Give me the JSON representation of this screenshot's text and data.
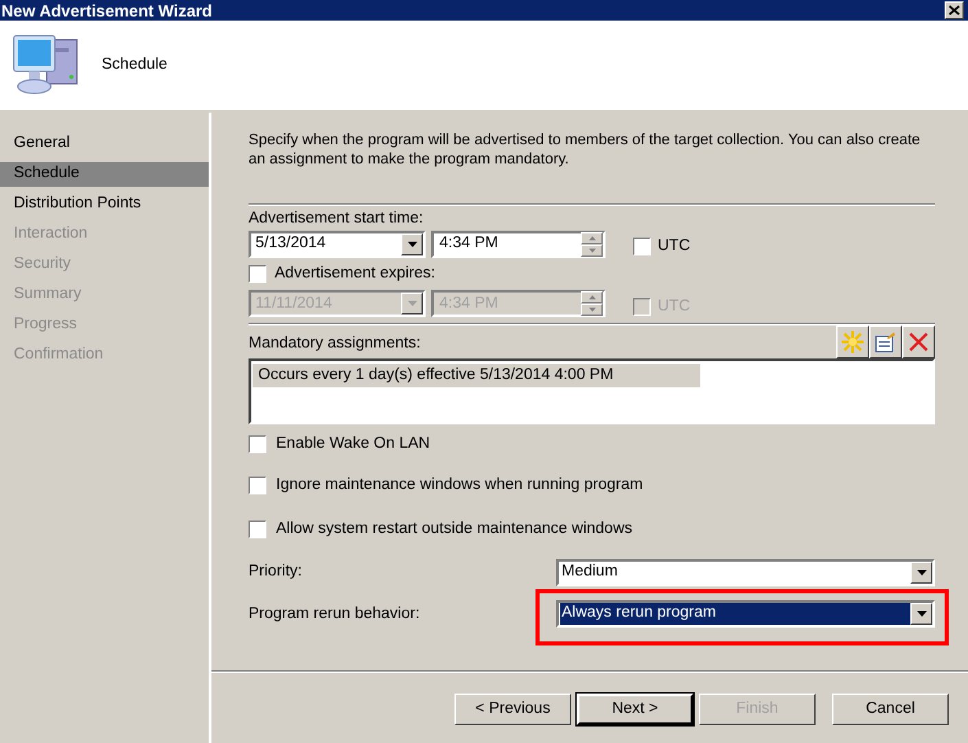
{
  "window": {
    "title": "New Advertisement Wizard"
  },
  "header": {
    "title": "Schedule"
  },
  "sidebar": {
    "items": [
      {
        "label": "General",
        "selected": false,
        "disabled": false
      },
      {
        "label": "Schedule",
        "selected": true,
        "disabled": false
      },
      {
        "label": "Distribution Points",
        "selected": false,
        "disabled": false
      },
      {
        "label": "Interaction",
        "selected": false,
        "disabled": true
      },
      {
        "label": "Security",
        "selected": false,
        "disabled": true
      },
      {
        "label": "Summary",
        "selected": false,
        "disabled": true
      },
      {
        "label": "Progress",
        "selected": false,
        "disabled": true
      },
      {
        "label": "Confirmation",
        "selected": false,
        "disabled": true
      }
    ]
  },
  "description": "Specify when the program will be advertised to members of the target collection. You can also create an assignment to make the program mandatory.",
  "start_time": {
    "label": "Advertisement start time:",
    "date": "5/13/2014",
    "time": "4:34 PM",
    "disabled": false,
    "utc": {
      "label": "UTC",
      "checked": false,
      "disabled": false
    }
  },
  "expires": {
    "label": "Advertisement expires:",
    "checked": false,
    "date": "11/11/2014",
    "time": "4:34 PM",
    "disabled": true,
    "utc": {
      "label": "UTC",
      "checked": false,
      "disabled": true
    }
  },
  "mandatory": {
    "label": "Mandatory assignments:",
    "items": [
      {
        "text": "Occurs every 1 day(s) effective 5/13/2014 4:00 PM",
        "selected": true
      }
    ]
  },
  "options": [
    {
      "label": "Enable Wake On LAN",
      "checked": false
    },
    {
      "label": "Ignore maintenance windows when running program",
      "checked": false
    },
    {
      "label": "Allow system restart outside maintenance windows",
      "checked": false
    }
  ],
  "priority": {
    "label": "Priority:",
    "value": "Medium",
    "focused": false,
    "highlighted": false
  },
  "rerun": {
    "label": "Program rerun behavior:",
    "value": "Always rerun program",
    "focused": true,
    "highlighted": true
  },
  "buttons": [
    {
      "label": "< Previous",
      "disabled": false,
      "default": false
    },
    {
      "label": "Next >",
      "disabled": false,
      "default": true
    },
    {
      "label": "Finish",
      "disabled": true,
      "default": false
    },
    {
      "label": "Cancel",
      "disabled": false,
      "default": false
    }
  ]
}
